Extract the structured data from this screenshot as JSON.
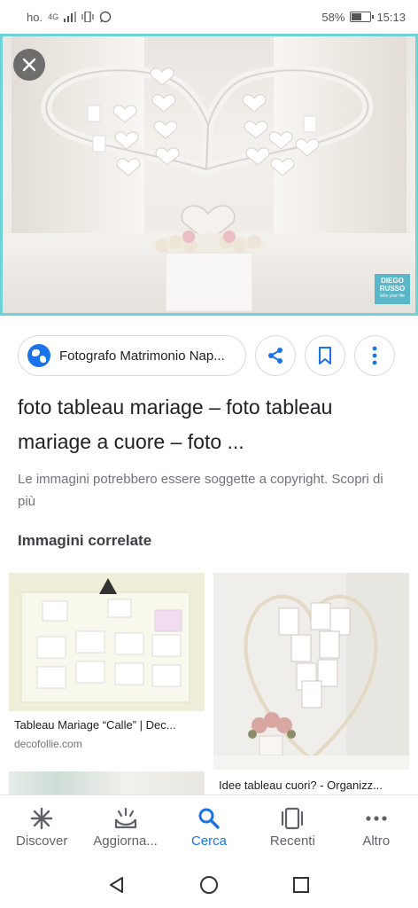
{
  "status_bar": {
    "carrier": "ho.",
    "network": "4G",
    "battery_percent": "58%",
    "battery_level": 0.58,
    "time": "15:13"
  },
  "viewer": {
    "close_icon": "close-icon",
    "watermark_line1": "DIEGO",
    "watermark_line2": "RUSSO",
    "watermark_line3": "tells your life"
  },
  "source": {
    "site_name": "Fotografo Matrimonio Nap...",
    "icons": [
      "globe-icon",
      "share-icon",
      "bookmark-icon",
      "more-vert-icon"
    ]
  },
  "result": {
    "title": "foto tableau mariage – foto tableau mariage a cuore – foto ...",
    "copyright_notice": "Le immagini potrebbero essere soggette a copyright. Scopri di più"
  },
  "related": {
    "heading": "Immagini correlate",
    "items": [
      {
        "title": "Tableau Mariage “Calle” | Dec...",
        "domain": "decofollie.com"
      },
      {
        "title": "Idee tableau cuori? - Organizz...",
        "domain": ""
      },
      {
        "title": "",
        "domain": ""
      }
    ]
  },
  "bottom_nav": {
    "items": [
      {
        "label": "Discover",
        "icon": "asterisk-icon"
      },
      {
        "label": "Aggiorna...",
        "icon": "updates-icon"
      },
      {
        "label": "Cerca",
        "icon": "search-icon"
      },
      {
        "label": "Recenti",
        "icon": "tabs-icon"
      },
      {
        "label": "Altro",
        "icon": "more-horiz-icon"
      }
    ],
    "active": "Cerca"
  },
  "colors": {
    "accent": "#1a73e8",
    "text_primary": "#202124",
    "text_secondary": "#70757a",
    "hero_border": "#6fd3d6"
  }
}
